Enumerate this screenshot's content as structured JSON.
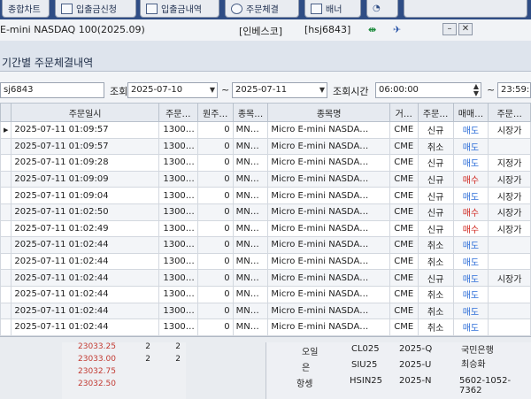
{
  "toolbar": {
    "buttons": [
      {
        "label": "종합차트",
        "icon": "chart-icon"
      },
      {
        "label": "입출금신청",
        "icon": "deposit-icon"
      },
      {
        "label": "입출금내역",
        "icon": "history-icon"
      },
      {
        "label": "주문체결",
        "icon": "order-icon"
      },
      {
        "label": "배너",
        "icon": "banner-icon"
      }
    ]
  },
  "window": {
    "title": "E-mini NASDAQ 100(2025.09)",
    "broker": "[인베스코]",
    "account": "[hsj6843]"
  },
  "panel": {
    "title": "기간별 주문체결내역"
  },
  "filters": {
    "account": "sj6843",
    "period_label": "조회기간",
    "start_date": "2025-07-10",
    "end_date": "2025-07-11",
    "tilde": "~",
    "time_label": "조회시간",
    "start_time": "06:00:00",
    "end_time": "23:59:5"
  },
  "table": {
    "columns": [
      "주문일시",
      "주문…",
      "원주…",
      "종목…",
      "종목명",
      "거…",
      "주문…",
      "매매…",
      "주문…"
    ],
    "rows": [
      {
        "datetime": "2025-07-11 01:09:57",
        "order_no": "1300…",
        "orig_no": "0",
        "code": "MN…",
        "name": "Micro E-mini NASDA…",
        "exch": "CME",
        "type": "신규",
        "side": "매도",
        "price_type": "시장가"
      },
      {
        "datetime": "2025-07-11 01:09:57",
        "order_no": "1300…",
        "orig_no": "0",
        "code": "MN…",
        "name": "Micro E-mini NASDA…",
        "exch": "CME",
        "type": "취소",
        "side": "매도",
        "price_type": ""
      },
      {
        "datetime": "2025-07-11 01:09:28",
        "order_no": "1300…",
        "orig_no": "0",
        "code": "MN…",
        "name": "Micro E-mini NASDA…",
        "exch": "CME",
        "type": "신규",
        "side": "매도",
        "price_type": "지정가"
      },
      {
        "datetime": "2025-07-11 01:09:09",
        "order_no": "1300…",
        "orig_no": "0",
        "code": "MN…",
        "name": "Micro E-mini NASDA…",
        "exch": "CME",
        "type": "신규",
        "side": "매수",
        "price_type": "시장가"
      },
      {
        "datetime": "2025-07-11 01:09:04",
        "order_no": "1300…",
        "orig_no": "0",
        "code": "MN…",
        "name": "Micro E-mini NASDA…",
        "exch": "CME",
        "type": "신규",
        "side": "매도",
        "price_type": "시장가"
      },
      {
        "datetime": "2025-07-11 01:02:50",
        "order_no": "1300…",
        "orig_no": "0",
        "code": "MN…",
        "name": "Micro E-mini NASDA…",
        "exch": "CME",
        "type": "신규",
        "side": "매수",
        "price_type": "시장가"
      },
      {
        "datetime": "2025-07-11 01:02:49",
        "order_no": "1300…",
        "orig_no": "0",
        "code": "MN…",
        "name": "Micro E-mini NASDA…",
        "exch": "CME",
        "type": "신규",
        "side": "매수",
        "price_type": "시장가"
      },
      {
        "datetime": "2025-07-11 01:02:44",
        "order_no": "1300…",
        "orig_no": "0",
        "code": "MN…",
        "name": "Micro E-mini NASDA…",
        "exch": "CME",
        "type": "취소",
        "side": "매도",
        "price_type": ""
      },
      {
        "datetime": "2025-07-11 01:02:44",
        "order_no": "1300…",
        "orig_no": "0",
        "code": "MN…",
        "name": "Micro E-mini NASDA…",
        "exch": "CME",
        "type": "취소",
        "side": "매도",
        "price_type": ""
      },
      {
        "datetime": "2025-07-11 01:02:44",
        "order_no": "1300…",
        "orig_no": "0",
        "code": "MN…",
        "name": "Micro E-mini NASDA…",
        "exch": "CME",
        "type": "신규",
        "side": "매도",
        "price_type": "시장가"
      },
      {
        "datetime": "2025-07-11 01:02:44",
        "order_no": "1300…",
        "orig_no": "0",
        "code": "MN…",
        "name": "Micro E-mini NASDA…",
        "exch": "CME",
        "type": "취소",
        "side": "매도",
        "price_type": ""
      },
      {
        "datetime": "2025-07-11 01:02:44",
        "order_no": "1300…",
        "orig_no": "0",
        "code": "MN…",
        "name": "Micro E-mini NASDA…",
        "exch": "CME",
        "type": "취소",
        "side": "매도",
        "price_type": ""
      },
      {
        "datetime": "2025-07-11 01:02:44",
        "order_no": "1300…",
        "orig_no": "0",
        "code": "MN…",
        "name": "Micro E-mini NASDA…",
        "exch": "CME",
        "type": "취소",
        "side": "매도",
        "price_type": ""
      }
    ]
  },
  "quotes": [
    {
      "price": "23033.25",
      "a": "2",
      "b": "2"
    },
    {
      "price": "23033.00",
      "a": "2",
      "b": "2"
    },
    {
      "price": "23032.75",
      "a": "",
      "b": ""
    },
    {
      "price": "23032.50",
      "a": "",
      "b": ""
    }
  ],
  "info": {
    "names": [
      "오일",
      "은",
      "항셍"
    ],
    "codes": [
      "CL025",
      "SIU25",
      "HSIN25"
    ],
    "months": [
      "2025-Q",
      "2025-U",
      "2025-N"
    ],
    "bank": "국민은행",
    "holder": "최승화",
    "account_no": "5602-1052-7362"
  },
  "colors": {
    "buy": "#d0271f",
    "sell": "#2f6fd8",
    "topbar": "#2f4d85"
  }
}
